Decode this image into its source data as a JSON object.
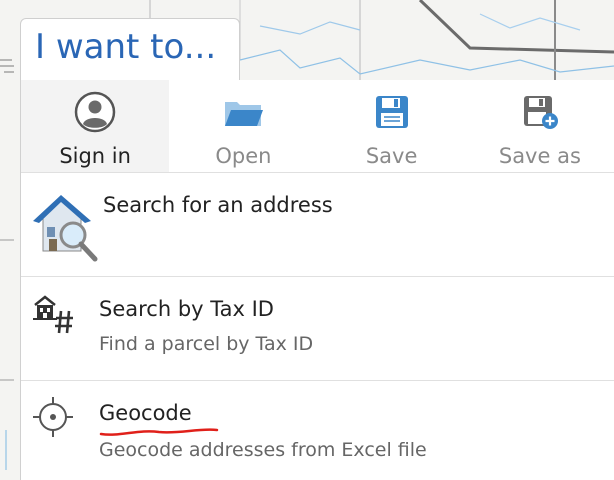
{
  "iwant": {
    "label": "I want to..."
  },
  "toolbar": {
    "items": [
      {
        "label": "Sign in",
        "icon": "user-icon",
        "active": true
      },
      {
        "label": "Open",
        "icon": "folder-icon",
        "active": false
      },
      {
        "label": "Save",
        "icon": "save-icon",
        "active": false
      },
      {
        "label": "Save as",
        "icon": "save-as-icon",
        "active": false
      }
    ]
  },
  "menu": {
    "items": [
      {
        "title": "Search for an address",
        "subtitle": "",
        "icon": "house-search-icon"
      },
      {
        "title": "Search by Tax ID",
        "subtitle": "Find a parcel by Tax ID",
        "icon": "tax-parcel-icon"
      },
      {
        "title": "Geocode",
        "subtitle": "Geocode addresses from Excel file",
        "icon": "crosshair-icon"
      }
    ]
  },
  "colors": {
    "accent": "#2a66b5",
    "toolbar_icon": "#3b86c9",
    "annotation": "#e0201a"
  }
}
